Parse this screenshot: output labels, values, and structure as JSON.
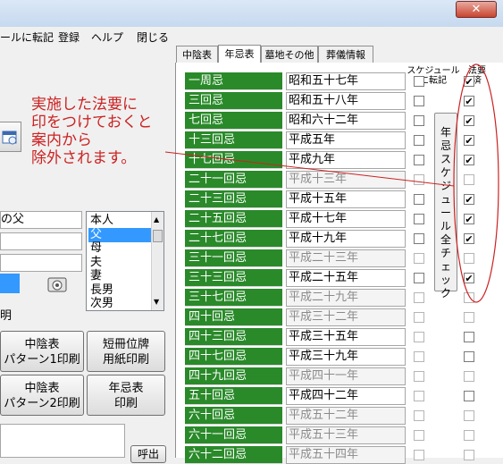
{
  "window": {
    "close_glyph": "✕"
  },
  "menu": [
    {
      "label": "ールに転記"
    },
    {
      "label": "登録"
    },
    {
      "label": "ヘルプ"
    },
    {
      "label": "閉じる"
    }
  ],
  "tabs": [
    {
      "label": "中陰表"
    },
    {
      "label": "年忌表"
    },
    {
      "label": "墓地その他"
    },
    {
      "label": "葬儀情報"
    }
  ],
  "columns": {
    "schedule": "スケジュールに転記",
    "done": "法要済"
  },
  "rows": [
    {
      "label": "一周忌",
      "date": "昭和五十七年",
      "dim": false,
      "sched": false,
      "done": true
    },
    {
      "label": "三回忌",
      "date": "昭和五十八年",
      "dim": false,
      "sched": false,
      "done": true
    },
    {
      "label": "七回忌",
      "date": "昭和六十二年",
      "dim": false,
      "sched": false,
      "done": true
    },
    {
      "label": "十三回忌",
      "date": "平成五年",
      "dim": false,
      "sched": false,
      "done": true
    },
    {
      "label": "十七回忌",
      "date": "平成九年",
      "dim": false,
      "sched": false,
      "done": true
    },
    {
      "label": "二十一回忌",
      "date": "平成十三年",
      "dim": true,
      "sched": false,
      "done": false
    },
    {
      "label": "二十三回忌",
      "date": "平成十五年",
      "dim": false,
      "sched": false,
      "done": true
    },
    {
      "label": "二十五回忌",
      "date": "平成十七年",
      "dim": false,
      "sched": false,
      "done": true
    },
    {
      "label": "二十七回忌",
      "date": "平成十九年",
      "dim": false,
      "sched": false,
      "done": true
    },
    {
      "label": "三十一回忌",
      "date": "平成二十三年",
      "dim": true,
      "sched": false,
      "done": false
    },
    {
      "label": "三十三回忌",
      "date": "平成二十五年",
      "dim": false,
      "sched": false,
      "done": true
    },
    {
      "label": "三十七回忌",
      "date": "平成二十九年",
      "dim": true,
      "sched": false,
      "done": false
    },
    {
      "label": "四十回忌",
      "date": "平成三十二年",
      "dim": true,
      "sched": false,
      "done": false
    },
    {
      "label": "四十三回忌",
      "date": "平成三十五年",
      "dim": false,
      "sched": false,
      "done": false
    },
    {
      "label": "四十七回忌",
      "date": "平成三十九年",
      "dim": false,
      "sched": false,
      "done": false
    },
    {
      "label": "四十九回忌",
      "date": "平成四十一年",
      "dim": true,
      "sched": false,
      "done": false
    },
    {
      "label": "五十回忌",
      "date": "平成四十二年",
      "dim": false,
      "sched": false,
      "done": false
    },
    {
      "label": "六十回忌",
      "date": "平成五十二年",
      "dim": true,
      "sched": false,
      "done": false
    },
    {
      "label": "六十一回忌",
      "date": "平成五十三年",
      "dim": true,
      "sched": false,
      "done": false
    },
    {
      "label": "六十二回忌",
      "date": "平成五十四年",
      "dim": true,
      "sched": false,
      "done": false
    }
  ],
  "vertical_button": "年忌スケジュール全チェック",
  "annotation": [
    "実施した法要に",
    "印をつけておくと",
    "案内から",
    "除外されます。"
  ],
  "left": {
    "field1_text": "の父",
    "field3_text": "明",
    "listbox_items": [
      "本人",
      "父",
      "母",
      "夫",
      "妻",
      "長男",
      "次男"
    ],
    "listbox_selected": 1,
    "buttons": [
      {
        "line1": "中陰表",
        "line2": "パターン1印刷"
      },
      {
        "line1": "短冊位牌",
        "line2": "用紙印刷"
      },
      {
        "line1": "中陰表",
        "line2": "パターン2印刷"
      },
      {
        "line1": "年忌表",
        "line2": "印刷"
      }
    ],
    "bottom_btn": "呼出"
  },
  "colors": {
    "label_green": "#2a8a2a",
    "annotation_red": "#cc2222",
    "selection_blue": "#3399ff"
  },
  "icons": [
    "calendar-icon",
    "camera-icon",
    "close-icon",
    "checkmark-icon"
  ]
}
